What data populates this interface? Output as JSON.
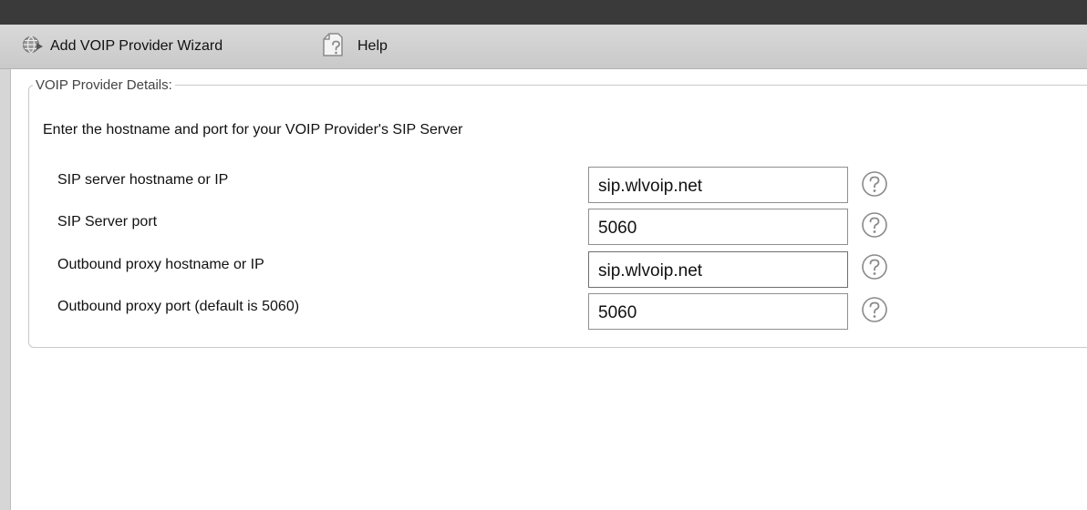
{
  "toolbar": {
    "wizard_label": "Add VOIP Provider Wizard",
    "help_label": "Help",
    "wizard_icon": "globe-icon",
    "help_icon": "help-page-icon"
  },
  "fieldset": {
    "legend": "VOIP Provider Details:",
    "intro": "Enter the hostname and port for your VOIP Provider's SIP Server"
  },
  "fields": [
    {
      "label": "SIP server hostname or IP",
      "value": "sip.wlvoip.net"
    },
    {
      "label": "SIP Server port",
      "value": "5060"
    },
    {
      "label": "Outbound proxy hostname or IP",
      "value": "sip.wlvoip.net"
    },
    {
      "label": "Outbound proxy port (default is 5060)",
      "value": "5060"
    }
  ],
  "colors": {
    "topbar": "#3a3a3a",
    "toolbar": "#d0d0d0",
    "help_icon_stroke": "#8a8a8a"
  }
}
